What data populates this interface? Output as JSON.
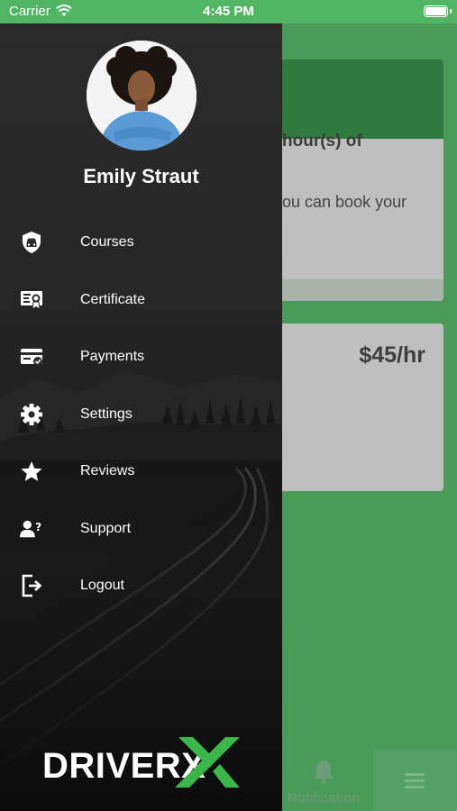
{
  "status_bar": {
    "carrier": "Carrier",
    "time": "4:45 PM"
  },
  "background": {
    "card_text_1": "hour(s) of",
    "card_text_2": "ou can book your",
    "price": "$45/hr",
    "notification_label": "Notification"
  },
  "drawer": {
    "user_name": "Emily Straut",
    "menu": [
      {
        "label": "Courses",
        "icon": "shield-car-icon"
      },
      {
        "label": "Certificate",
        "icon": "certificate-icon"
      },
      {
        "label": "Payments",
        "icon": "credit-card-icon"
      },
      {
        "label": "Settings",
        "icon": "gear-icon"
      },
      {
        "label": "Reviews",
        "icon": "star-icon"
      },
      {
        "label": "Support",
        "icon": "person-question-icon"
      },
      {
        "label": "Logout",
        "icon": "logout-icon"
      }
    ],
    "logo": "DRIVERX"
  },
  "colors": {
    "accent": "#52b563",
    "drawer_bg": "#262626",
    "logo_x": "#3cb54a"
  }
}
